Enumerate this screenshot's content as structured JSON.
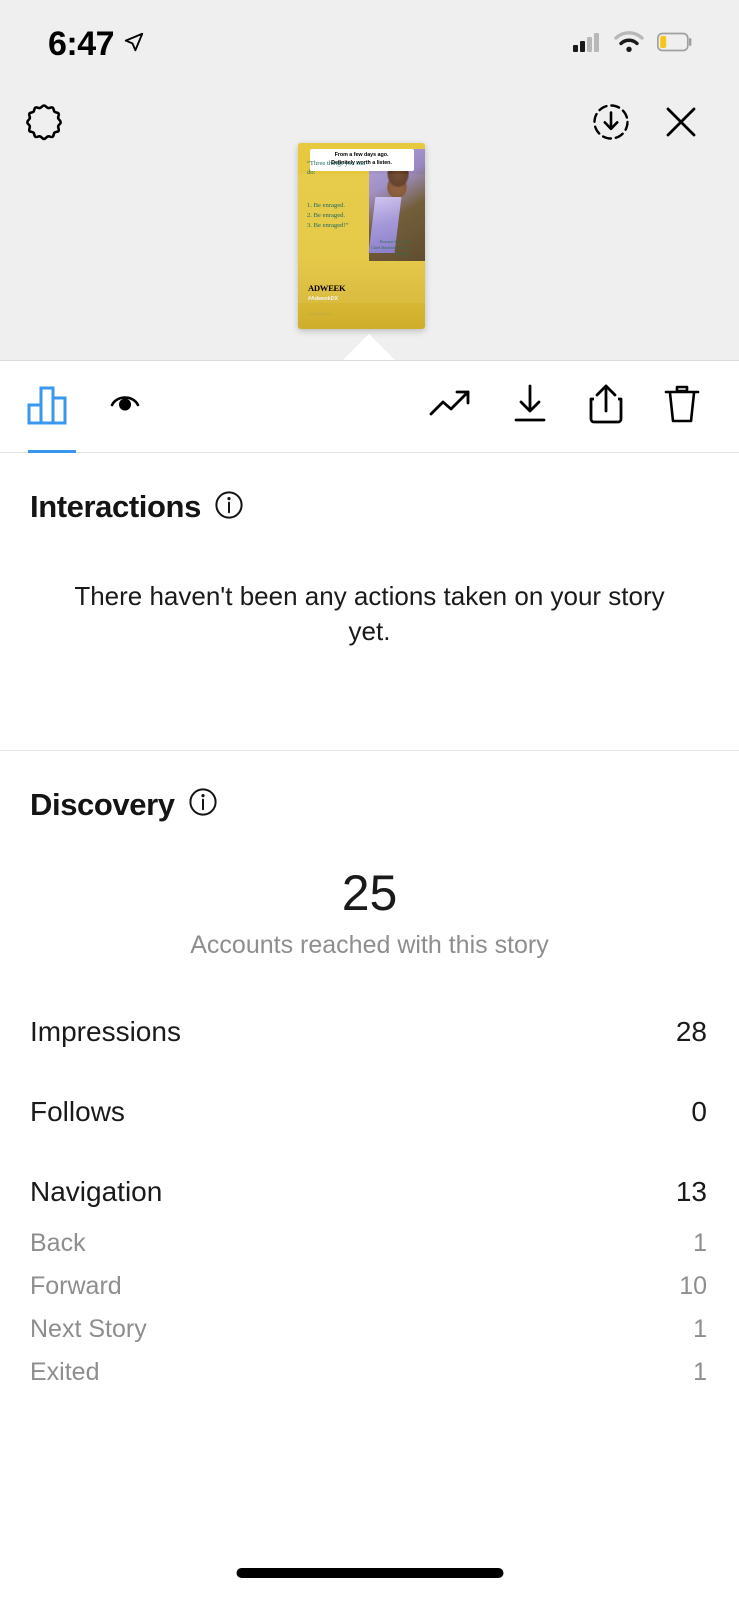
{
  "status_bar": {
    "time": "6:47",
    "location_icon": "location-arrow-icon",
    "signal_icon": "cellular-signal-icon",
    "signal_bars_filled": 2,
    "signal_bars_total": 4,
    "wifi_icon": "wifi-icon",
    "battery_icon": "battery-low-icon",
    "battery_color": "#f5c518"
  },
  "top_bar": {
    "settings_label": "settings",
    "settings_icon": "gear-icon",
    "save_label": "save",
    "save_icon": "download-circle-icon",
    "close_label": "close",
    "close_icon": "close-icon"
  },
  "story_preview": {
    "caption_line1": "From a few days ago.",
    "caption_line2": "Definitely worth a listen.",
    "quote_open": "“Three things you can do:",
    "list_item_1": "1. Be enraged.",
    "list_item_2": "2. Be enraged.",
    "list_item_3": "3. Be enraged!”",
    "attribution_name": "- Bozoma Saint John",
    "attribution_title": "Chief Marketing Officer,",
    "attribution_company": "Endeavor",
    "brand_logo": "ADWEEK",
    "hashtag": "#AdweekDX",
    "fine_print": "Q Brand Studio",
    "background_color": "#e4c53c",
    "quote_color": "#1f6b62"
  },
  "toolbar": {
    "insights_tab_label": "insights",
    "insights_tab_icon": "bar-chart-icon",
    "insights_tab_active": true,
    "viewers_label": "viewers",
    "viewers_icon": "eye-icon",
    "promote_label": "promote",
    "promote_icon": "trending-up-icon",
    "download_label": "download",
    "download_icon": "download-icon",
    "share_label": "share",
    "share_icon": "share-icon",
    "delete_label": "delete",
    "delete_icon": "trash-icon",
    "active_color": "#3897f0"
  },
  "interactions": {
    "title": "Interactions",
    "info_icon": "info-icon",
    "empty_message": "There haven't been any actions taken on your story yet."
  },
  "discovery": {
    "title": "Discovery",
    "info_icon": "info-icon",
    "headline_value": "25",
    "headline_label": "Accounts reached with this story",
    "rows": [
      {
        "name": "Impressions",
        "value": "28",
        "level": "primary"
      },
      {
        "name": "Follows",
        "value": "0",
        "level": "primary"
      },
      {
        "name": "Navigation",
        "value": "13",
        "level": "primary"
      },
      {
        "name": "Back",
        "value": "1",
        "level": "sub"
      },
      {
        "name": "Forward",
        "value": "10",
        "level": "sub"
      },
      {
        "name": "Next Story",
        "value": "1",
        "level": "sub"
      },
      {
        "name": "Exited",
        "value": "1",
        "level": "sub"
      }
    ]
  },
  "home_indicator": "home-indicator"
}
